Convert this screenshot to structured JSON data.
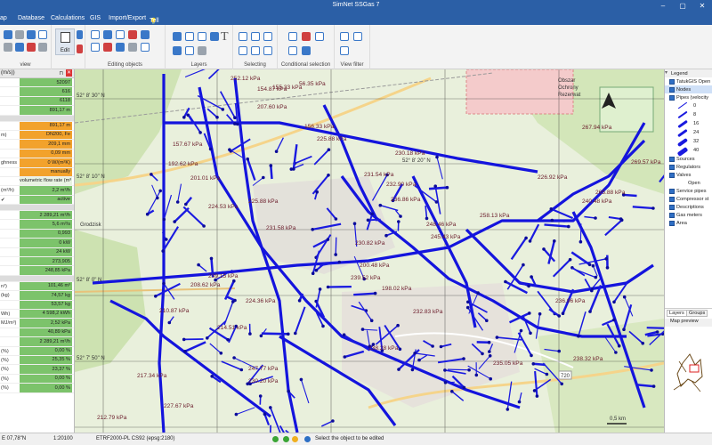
{
  "window": {
    "title": "SimNet SSGas 7"
  },
  "menu": [
    "ap",
    "Database",
    "Calculations",
    "GIS",
    "Import/Export"
  ],
  "tell_me": "Tell me, what you want to do",
  "ribbon": {
    "groups": [
      "view",
      "Edit",
      "Editing objects",
      "Layers",
      "Selecting",
      "Conditional selection",
      "View filter"
    ]
  },
  "left_panel": {
    "header": "(m/s))",
    "rows": [
      {
        "k": "",
        "v": "52097",
        "c": "green"
      },
      {
        "k": "",
        "v": "616",
        "c": "green"
      },
      {
        "k": "",
        "v": "6118",
        "c": "green"
      },
      {
        "k": "",
        "v": "891,17 m",
        "c": "green"
      },
      {
        "k": "",
        "v": "",
        "c": "section"
      },
      {
        "k": "",
        "v": "891,17 m",
        "c": "orange"
      },
      {
        "k": "m)",
        "v": "DN200, Fe",
        "c": "orange"
      },
      {
        "k": "",
        "v": "209,1 mm",
        "c": "orange"
      },
      {
        "k": "",
        "v": "0,09 mm",
        "c": "orange"
      },
      {
        "k": "ghness",
        "v": "0 W/(m²K)",
        "c": "orange"
      },
      {
        "k": "",
        "v": "manually",
        "c": "orange"
      },
      {
        "k": "",
        "v": "volumetric flow rate (m³",
        "c": "light"
      },
      {
        "k": "(m³/h)",
        "v": "2,2 m³/h",
        "c": "green"
      },
      {
        "k": "✔",
        "v": "active",
        "c": "green"
      },
      {
        "k": "",
        "v": "",
        "c": "section"
      },
      {
        "k": "",
        "v": "2 289,21 m³/h",
        "c": "green"
      },
      {
        "k": "",
        "v": "5,6 m³/s",
        "c": "green"
      },
      {
        "k": "",
        "v": "0,993",
        "c": "green"
      },
      {
        "k": "",
        "v": "0 kW",
        "c": "green"
      },
      {
        "k": "",
        "v": "24 kW",
        "c": "green"
      },
      {
        "k": "",
        "v": "273,905",
        "c": "green"
      },
      {
        "k": "",
        "v": "248,85 kPa",
        "c": "green"
      },
      {
        "k": "",
        "v": "",
        "c": "section"
      },
      {
        "k": "n³)",
        "v": "101,46 m³",
        "c": "green"
      },
      {
        "k": "(kg)",
        "v": "74,57 kg",
        "c": "green"
      },
      {
        "k": "",
        "v": "53,57 kg",
        "c": "green"
      },
      {
        "k": "Wh)",
        "v": "4 598,2 kWh",
        "c": "green"
      },
      {
        "k": "MJ/m³)",
        "v": "2,52 kPa",
        "c": "green"
      },
      {
        "k": "",
        "v": "40,89 kPa",
        "c": "green"
      },
      {
        "k": "",
        "v": "2 289,21 m³/h",
        "c": "green"
      },
      {
        "k": "(%)",
        "v": "0,00 %",
        "c": "green"
      },
      {
        "k": "(%)",
        "v": "25,35 %",
        "c": "green"
      },
      {
        "k": "(%)",
        "v": "23,37 %",
        "c": "green"
      },
      {
        "k": "(%)",
        "v": "0,00 %",
        "c": "green"
      },
      {
        "k": "(%)",
        "v": "0,00 %",
        "c": "green"
      }
    ]
  },
  "map": {
    "coords_top": [
      "52° 8' 30\" N",
      "52° 8' 20\" N",
      "52° 8' 10\" N",
      "52° 8' 0\" N",
      "52° 7' 50\" N"
    ],
    "area_labels": [
      "Obszar",
      "Ochrony",
      "Rezerwat",
      "Grodzisk"
    ],
    "road_number": "720",
    "scale_label": "0,5 km",
    "pressure_labels": [
      {
        "t": "154.87 kPa"
      },
      {
        "t": "56.35 kPa"
      },
      {
        "t": "155.33 kPa"
      },
      {
        "t": "207.60 kPa"
      },
      {
        "t": "252.12 kPa"
      },
      {
        "t": "156.33 kPa"
      },
      {
        "t": "225.88 kPa"
      },
      {
        "t": "157.67 kPa"
      },
      {
        "t": "230.18 kPa"
      },
      {
        "t": "192.62 kPa"
      },
      {
        "t": "201.01 kPa"
      },
      {
        "t": "231.54 kPa"
      },
      {
        "t": "232.90 kPa"
      },
      {
        "t": "236.86 kPa"
      },
      {
        "t": "224.53 kPa"
      },
      {
        "t": "225.88 kPa"
      },
      {
        "t": "248.46 kPa"
      },
      {
        "t": "258.13 kPa"
      },
      {
        "t": "240.48 kPa"
      },
      {
        "t": "226.92 kPa"
      },
      {
        "t": "265.88 kPa"
      },
      {
        "t": "267.94 kPa"
      },
      {
        "t": "269.57 kPa"
      },
      {
        "t": "231.58 kPa"
      },
      {
        "t": "230.82 kPa"
      },
      {
        "t": "200.48 kPa"
      },
      {
        "t": "245.43 kPa"
      },
      {
        "t": "239.15 kPa"
      },
      {
        "t": "239.52 kPa"
      },
      {
        "t": "208.62 kPa"
      },
      {
        "t": "224.36 kPa"
      },
      {
        "t": "198.02 kPa"
      },
      {
        "t": "232.83 kPa"
      },
      {
        "t": "210.87 kPa"
      },
      {
        "t": "214.51 kPa"
      },
      {
        "t": "236.96 kPa"
      },
      {
        "t": "247.77 kPa"
      },
      {
        "t": "238.28 kPa"
      },
      {
        "t": "235.05 kPa"
      },
      {
        "t": "217.34 kPa"
      },
      {
        "t": "212.79 kPa"
      },
      {
        "t": "227.67 kPa"
      },
      {
        "t": "230.20 kPa"
      },
      {
        "t": "238.32 kPa"
      }
    ]
  },
  "legend": {
    "title": "Legend",
    "rows": [
      {
        "t": "TatukGIS Open",
        "checked": true
      },
      {
        "t": "Nodes",
        "checked": true,
        "selected": true
      },
      {
        "t": "Pipes (velocity",
        "checked": true
      }
    ],
    "pipe_scale": [
      "0",
      "8",
      "16",
      "24",
      "32",
      "40"
    ],
    "rows2": [
      {
        "t": "Sources",
        "checked": true
      },
      {
        "t": "Regulators",
        "checked": true
      },
      {
        "t": "Valves",
        "checked": true
      },
      {
        "t": "Open",
        "checked": false
      },
      {
        "t": "Service pipes",
        "checked": true
      },
      {
        "t": "Compressor st",
        "checked": true
      },
      {
        "t": "Descriptions",
        "checked": true
      },
      {
        "t": "Gas meters",
        "checked": true
      },
      {
        "t": "Area",
        "checked": true
      }
    ],
    "tabs": [
      "Layers",
      "Groups"
    ],
    "preview_title": "Map preview"
  },
  "status": {
    "coord": "E 07,78\"N",
    "scale": "1:20100",
    "crs": "ETRF2000-PL CS92 (epsg:2180)",
    "msg": "Select the object to be edited"
  }
}
